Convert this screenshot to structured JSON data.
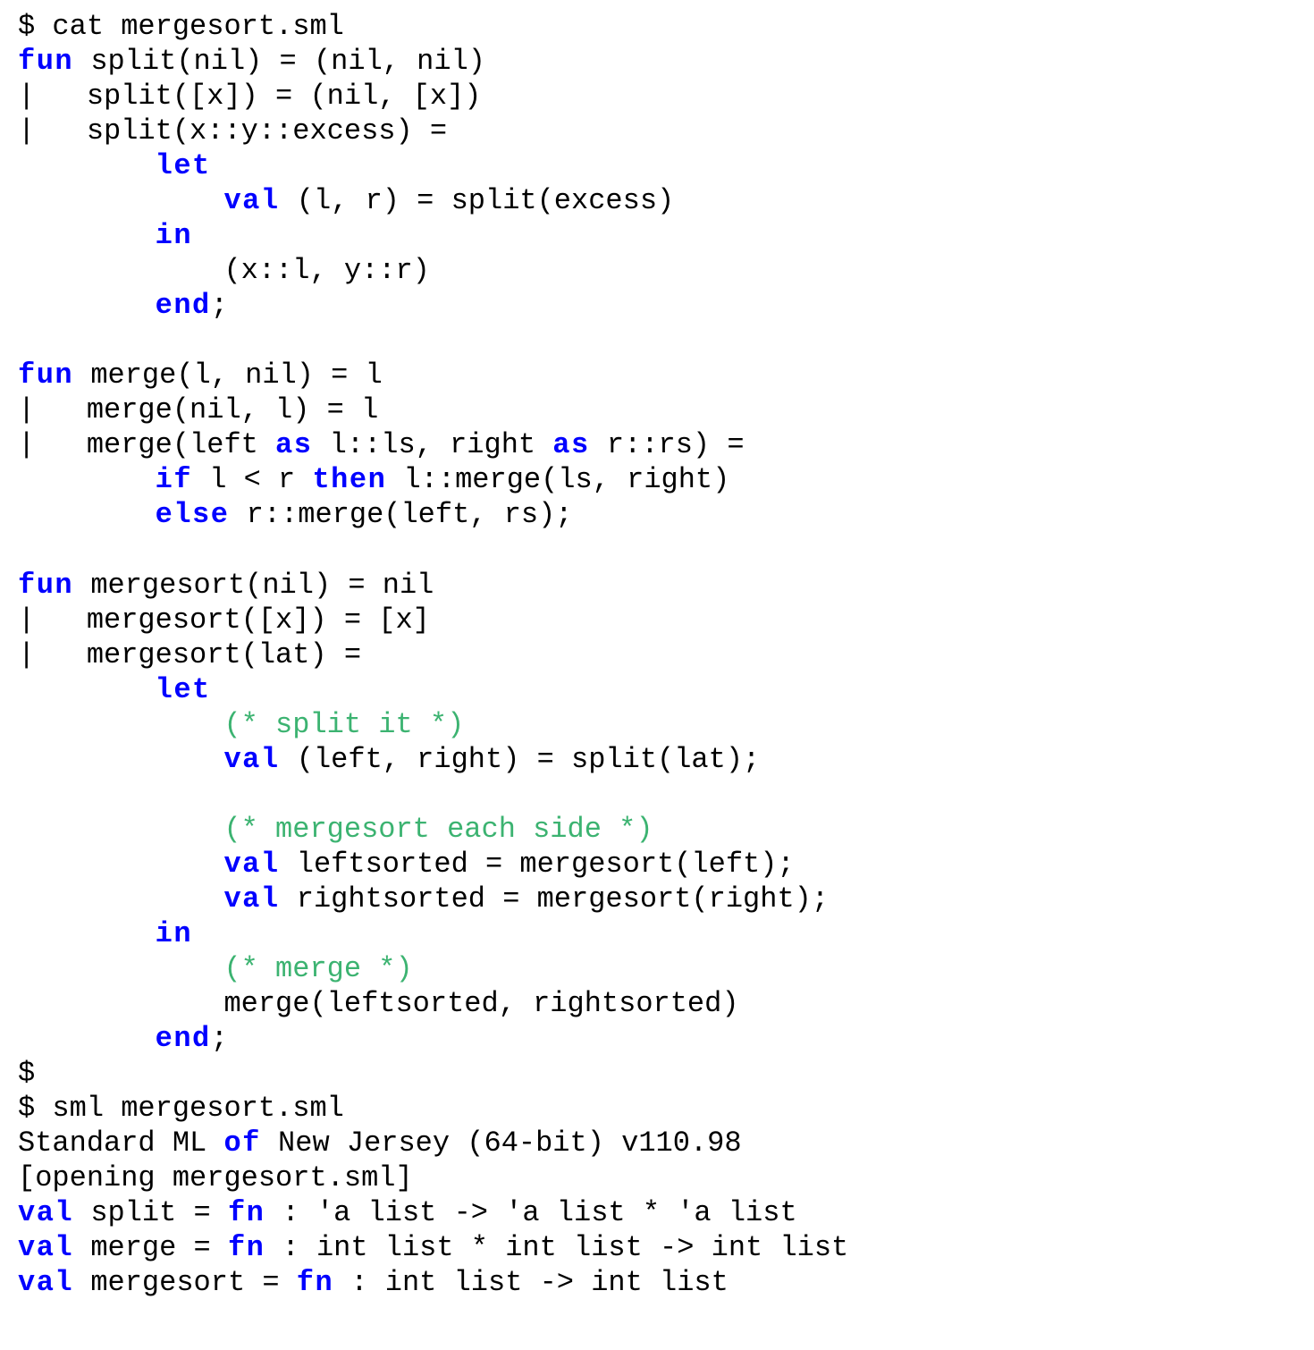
{
  "lines": [
    [
      {
        "t": "$ cat mergesort.sml"
      }
    ],
    [
      {
        "t": "fun",
        "c": "kw"
      },
      {
        "t": " split(nil) = (nil, nil)"
      }
    ],
    [
      {
        "t": "|   split([x]) = (nil, [x])"
      }
    ],
    [
      {
        "t": "|   split(x::y::excess) ="
      }
    ],
    [
      {
        "t": "        "
      },
      {
        "t": "let",
        "c": "kw"
      }
    ],
    [
      {
        "t": "            "
      },
      {
        "t": "val",
        "c": "kw"
      },
      {
        "t": " (l, r) = split(excess)"
      }
    ],
    [
      {
        "t": "        "
      },
      {
        "t": "in",
        "c": "kw"
      }
    ],
    [
      {
        "t": "            (x::l, y::r)"
      }
    ],
    [
      {
        "t": "        "
      },
      {
        "t": "end",
        "c": "kw"
      },
      {
        "t": ";"
      }
    ],
    [
      {
        "t": ""
      }
    ],
    [
      {
        "t": "fun",
        "c": "kw"
      },
      {
        "t": " merge(l, nil) = l"
      }
    ],
    [
      {
        "t": "|   merge(nil, l) = l"
      }
    ],
    [
      {
        "t": "|   merge(left "
      },
      {
        "t": "as",
        "c": "kw"
      },
      {
        "t": " l::ls, right "
      },
      {
        "t": "as",
        "c": "kw"
      },
      {
        "t": " r::rs) ="
      }
    ],
    [
      {
        "t": "        "
      },
      {
        "t": "if",
        "c": "kw"
      },
      {
        "t": " l < r "
      },
      {
        "t": "then",
        "c": "kw"
      },
      {
        "t": " l::merge(ls, right)"
      }
    ],
    [
      {
        "t": "        "
      },
      {
        "t": "else",
        "c": "kw"
      },
      {
        "t": " r::merge(left, rs);"
      }
    ],
    [
      {
        "t": ""
      }
    ],
    [
      {
        "t": "fun",
        "c": "kw"
      },
      {
        "t": " mergesort(nil) = nil"
      }
    ],
    [
      {
        "t": "|   mergesort([x]) = [x]"
      }
    ],
    [
      {
        "t": "|   mergesort(lat) ="
      }
    ],
    [
      {
        "t": "        "
      },
      {
        "t": "let",
        "c": "kw"
      }
    ],
    [
      {
        "t": "            "
      },
      {
        "t": "(* split it *)",
        "c": "cmt"
      }
    ],
    [
      {
        "t": "            "
      },
      {
        "t": "val",
        "c": "kw"
      },
      {
        "t": " (left, right) = split(lat);"
      }
    ],
    [
      {
        "t": ""
      }
    ],
    [
      {
        "t": "            "
      },
      {
        "t": "(* mergesort each side *)",
        "c": "cmt"
      }
    ],
    [
      {
        "t": "            "
      },
      {
        "t": "val",
        "c": "kw"
      },
      {
        "t": " leftsorted = mergesort(left);"
      }
    ],
    [
      {
        "t": "            "
      },
      {
        "t": "val",
        "c": "kw"
      },
      {
        "t": " rightsorted = mergesort(right);"
      }
    ],
    [
      {
        "t": "        "
      },
      {
        "t": "in",
        "c": "kw"
      }
    ],
    [
      {
        "t": "            "
      },
      {
        "t": "(* merge *)",
        "c": "cmt"
      }
    ],
    [
      {
        "t": "            merge(leftsorted, rightsorted)"
      }
    ],
    [
      {
        "t": "        "
      },
      {
        "t": "end",
        "c": "kw"
      },
      {
        "t": ";"
      }
    ],
    [
      {
        "t": "$"
      }
    ],
    [
      {
        "t": "$ sml mergesort.sml"
      }
    ],
    [
      {
        "t": "Standard ML "
      },
      {
        "t": "of",
        "c": "kw"
      },
      {
        "t": " New Jersey (64-bit) v110.98"
      }
    ],
    [
      {
        "t": "[opening mergesort.sml]"
      }
    ],
    [
      {
        "t": "val",
        "c": "kw"
      },
      {
        "t": " split = "
      },
      {
        "t": "fn",
        "c": "kw"
      },
      {
        "t": " : 'a list -> 'a list * 'a list"
      }
    ],
    [
      {
        "t": "val",
        "c": "kw"
      },
      {
        "t": " merge = "
      },
      {
        "t": "fn",
        "c": "kw"
      },
      {
        "t": " : int list * int list -> int list"
      }
    ],
    [
      {
        "t": "val",
        "c": "kw"
      },
      {
        "t": " mergesort = "
      },
      {
        "t": "fn",
        "c": "kw"
      },
      {
        "t": " : int list -> int list"
      }
    ]
  ]
}
